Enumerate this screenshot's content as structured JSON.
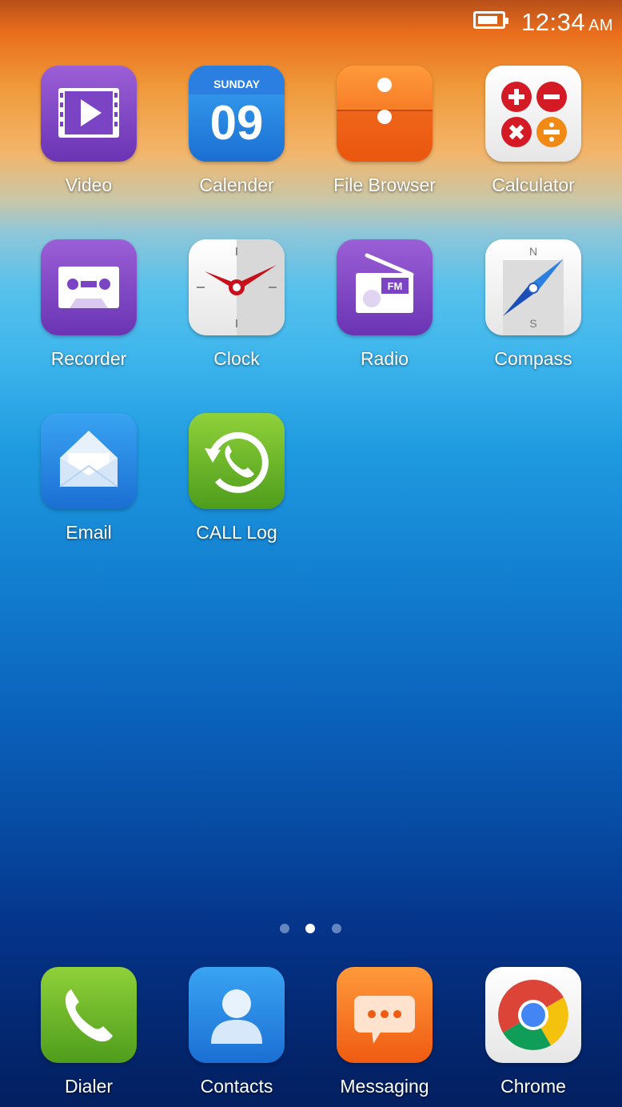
{
  "status_bar": {
    "time": "12:34",
    "ampm": "AM",
    "battery_level": 0.85
  },
  "apps": [
    {
      "label": "Video",
      "icon": "video-icon"
    },
    {
      "label": "Calender",
      "icon": "calendar-icon",
      "day": "SUNDAY",
      "date": "09"
    },
    {
      "label": "File Browser",
      "icon": "file-browser-icon"
    },
    {
      "label": "Calculator",
      "icon": "calculator-icon"
    },
    {
      "label": "Recorder",
      "icon": "recorder-icon"
    },
    {
      "label": "Clock",
      "icon": "clock-icon"
    },
    {
      "label": "Radio",
      "icon": "radio-icon",
      "badge": "FM"
    },
    {
      "label": "Compass",
      "icon": "compass-icon",
      "north": "N",
      "south": "S"
    },
    {
      "label": "Email",
      "icon": "email-icon"
    },
    {
      "label": "CALL Log",
      "icon": "call-log-icon"
    }
  ],
  "page_indicator": {
    "pages": 3,
    "current": 2
  },
  "dock": [
    {
      "label": "Dialer",
      "icon": "phone-icon"
    },
    {
      "label": "Contacts",
      "icon": "contacts-icon"
    },
    {
      "label": "Messaging",
      "icon": "messaging-icon"
    },
    {
      "label": "Chrome",
      "icon": "chrome-icon"
    }
  ]
}
